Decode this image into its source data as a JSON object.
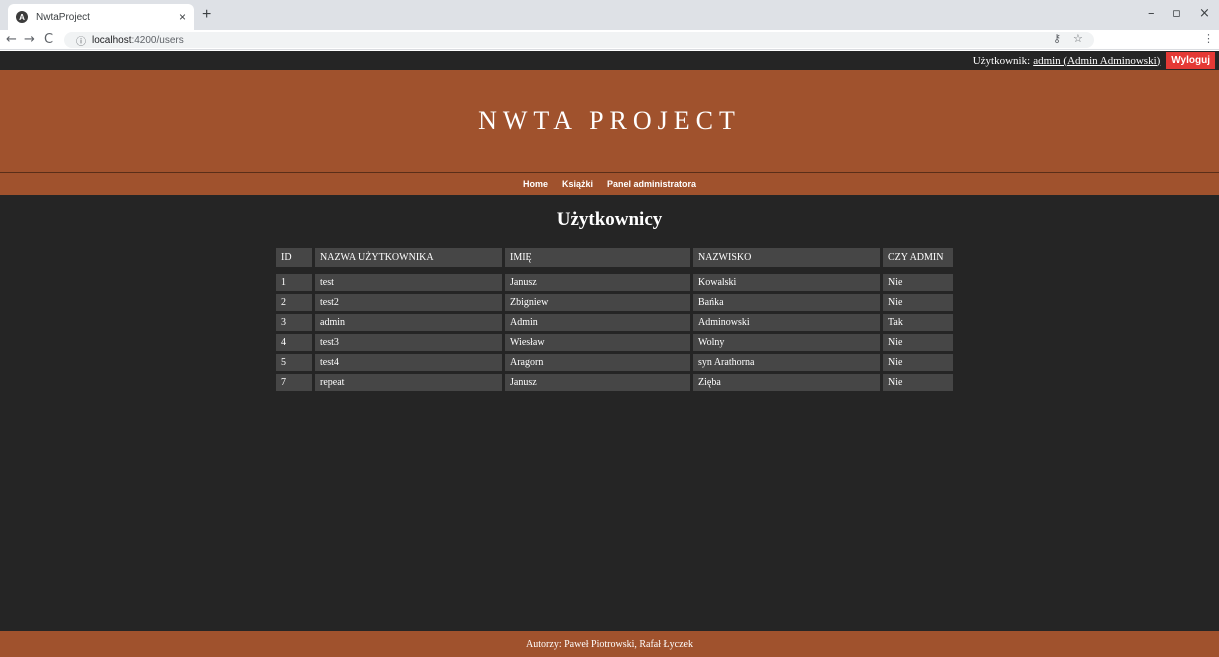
{
  "browser": {
    "tab_title": "NwtaProject",
    "tab_close": "×",
    "new_tab": "+",
    "minimize": "–",
    "maximize": "▫",
    "close": "×",
    "back": "←",
    "forward": "→",
    "reload": "C",
    "url_host": "localhost",
    "url_path": ":4200/users",
    "menu": "⋮"
  },
  "topbar": {
    "user_label": "Użytkownik:",
    "user_link": "admin (Admin Adminowski)",
    "logout_label": "Wyloguj"
  },
  "header": {
    "title": "NWTA PROJECT"
  },
  "nav": {
    "items": [
      "Home",
      "Książki",
      "Panel administratora"
    ]
  },
  "main": {
    "heading": "Użytkownicy"
  },
  "table": {
    "columns": [
      "ID",
      "NAZWA UŻYTKOWNIKA",
      "IMIĘ",
      "NAZWISKO",
      "CZY ADMIN"
    ],
    "rows": [
      [
        "1",
        "test",
        "Janusz",
        "Kowalski",
        "Nie"
      ],
      [
        "2",
        "test2",
        "Zbigniew",
        "Bańka",
        "Nie"
      ],
      [
        "3",
        "admin",
        "Admin",
        "Adminowski",
        "Tak"
      ],
      [
        "4",
        "test3",
        "Wiesław",
        "Wolny",
        "Nie"
      ],
      [
        "5",
        "test4",
        "Aragorn",
        "syn Arathorna",
        "Nie"
      ],
      [
        "7",
        "repeat",
        "Janusz",
        "Zięba",
        "Nie"
      ]
    ]
  },
  "footer": {
    "text": "Autorzy: Paweł Piotrowski, Rafał Łyczek"
  },
  "colors": {
    "brand": "#a0522d",
    "background": "#252525",
    "cell": "#464646",
    "logout": "#e53935"
  }
}
